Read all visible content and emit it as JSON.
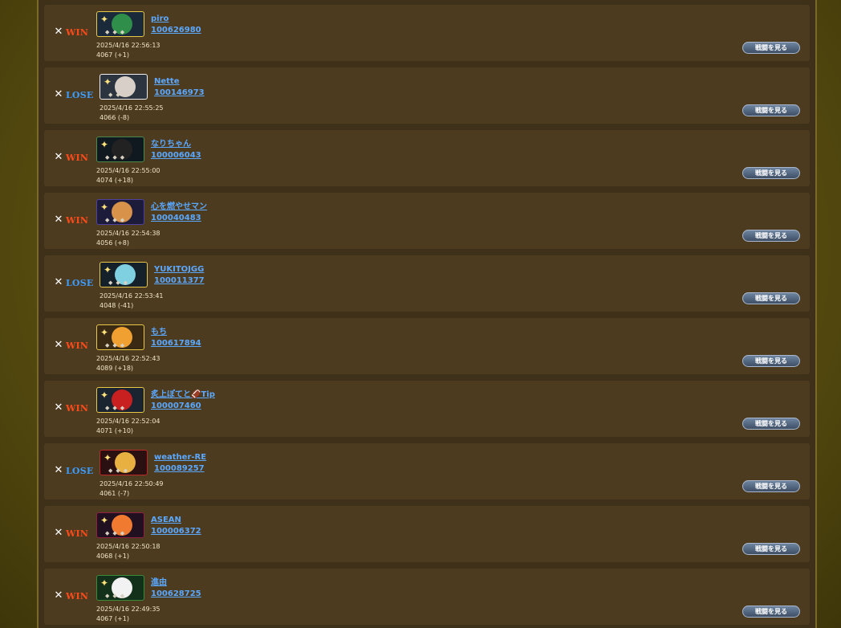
{
  "battle_button_label": "戦闘を見る",
  "win_label": "WIN",
  "lose_label": "LOSE",
  "swords_icon": "crossed-swords-icon",
  "colors": {
    "win": "#ff4a1a",
    "lose": "#3c9cff",
    "link": "#5aa8ff",
    "row_bg": "#4d3b20"
  },
  "battles": [
    {
      "result": "WIN",
      "name": "piro",
      "id": "100626980",
      "datetime": "2025/4/16 22:56:13",
      "rating": "4067 (+1)"
    },
    {
      "result": "LOSE",
      "name": "Nette",
      "id": "100146973",
      "datetime": "2025/4/16 22:55:25",
      "rating": "4066 (-8)"
    },
    {
      "result": "WIN",
      "name": "なりちゃん",
      "id": "100006043",
      "datetime": "2025/4/16 22:55:00",
      "rating": "4074 (+18)"
    },
    {
      "result": "WIN",
      "name": "心を燃やせマン",
      "id": "100040483",
      "datetime": "2025/4/16 22:54:38",
      "rating": "4056 (+8)"
    },
    {
      "result": "LOSE",
      "name": "YUKITOJGG",
      "id": "100011377",
      "datetime": "2025/4/16 22:53:41",
      "rating": "4048 (-41)"
    },
    {
      "result": "WIN",
      "name": "もち",
      "id": "100617894",
      "datetime": "2025/4/16 22:52:43",
      "rating": "4089 (+18)"
    },
    {
      "result": "WIN",
      "name": "炙上ぽてと🏈Tip",
      "id": "100007460",
      "datetime": "2025/4/16 22:52:04",
      "rating": "4071 (+10)"
    },
    {
      "result": "LOSE",
      "name": "weather-RE",
      "id": "100089257",
      "datetime": "2025/4/16 22:50:49",
      "rating": "4061 (-7)"
    },
    {
      "result": "WIN",
      "name": "ASEAN",
      "id": "100006372",
      "datetime": "2025/4/16 22:50:18",
      "rating": "4068 (+1)"
    },
    {
      "result": "WIN",
      "name": "進由",
      "id": "100628725",
      "datetime": "2025/4/16 22:49:35",
      "rating": "4067 (+1)"
    }
  ]
}
